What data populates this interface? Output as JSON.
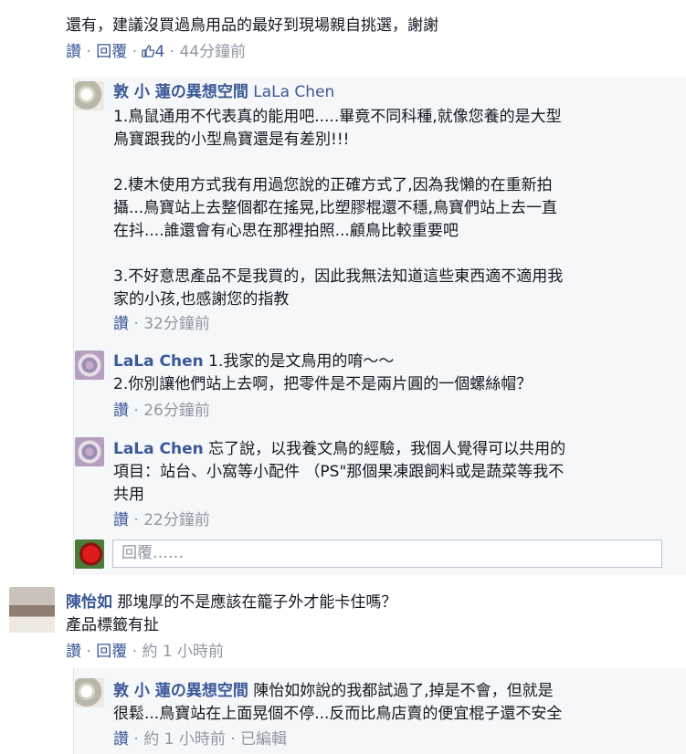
{
  "comments": [
    {
      "text": "還有，建議沒買過鳥用品的最好到現場親自挑選，謝謝",
      "actions": {
        "like": "讚",
        "reply": "回覆",
        "likes": "4",
        "time": "44分鐘前"
      },
      "replies": [
        {
          "author": "敦 小 蓮の異想空間",
          "author_en": "LaLa Chen",
          "lines": [
            "1.鳥鼠通用不代表真的能用吧.....畢竟不同科種,就像您養的是大型",
            "鳥寶跟我的小型鳥寶還是有差別!!!",
            "",
            "2.棲木使用方式我有用過您說的正確方式了,因為我懶的在重新拍",
            "攝...鳥寶站上去整個都在搖晃,比塑膠棍還不穩,鳥寶們站上去一直",
            "在抖....誰還會有心思在那裡拍照...顧鳥比較重要吧",
            "",
            "3.不好意思產品不是我買的，因此我無法知道這些東西適不適用我",
            "家的小孩,也感謝您的指教"
          ],
          "actions": {
            "like": "讚",
            "time": "32分鐘前"
          }
        },
        {
          "author": "LaLa Chen",
          "lines": [
            "1.我家的是文鳥用的唷～～",
            "2.你別讓他們站上去啊，把零件是不是兩片圓的一個螺絲帽？"
          ],
          "actions": {
            "like": "讚",
            "time": "26分鐘前"
          }
        },
        {
          "author": "LaLa Chen",
          "lines": [
            "忘了說，以我養文鳥的經驗，我個人覺得可以共用的",
            "項目：站台、小窩等小配件 （PS\"那個果凍跟飼料或是蔬菜等我不",
            "共用"
          ],
          "actions": {
            "like": "讚",
            "time": "22分鐘前"
          }
        }
      ],
      "reply_placeholder": "回覆……"
    },
    {
      "author": "陳怡如",
      "lines": [
        "那塊厚的不是應該在籠子外才能卡住嗎？",
        "產品標籤有扯"
      ],
      "actions": {
        "like": "讚",
        "reply": "回覆",
        "time": "約 1 小時前"
      },
      "replies": [
        {
          "author": "敦 小 蓮の異想空間",
          "lines": [
            "陳怡如妳說的我都試過了,掉是不會，但就是",
            "很鬆...鳥寶站在上面晃個不停...反而比鳥店賣的便宜棍子還不安全"
          ],
          "actions": {
            "like": "讚",
            "time": "約 1 小時前",
            "edited": "已編輯"
          }
        }
      ]
    }
  ],
  "colors": {
    "link": "#3b5998",
    "meta": "#9197a3",
    "text": "#141823",
    "reply_bg": "#f6f7f9"
  }
}
